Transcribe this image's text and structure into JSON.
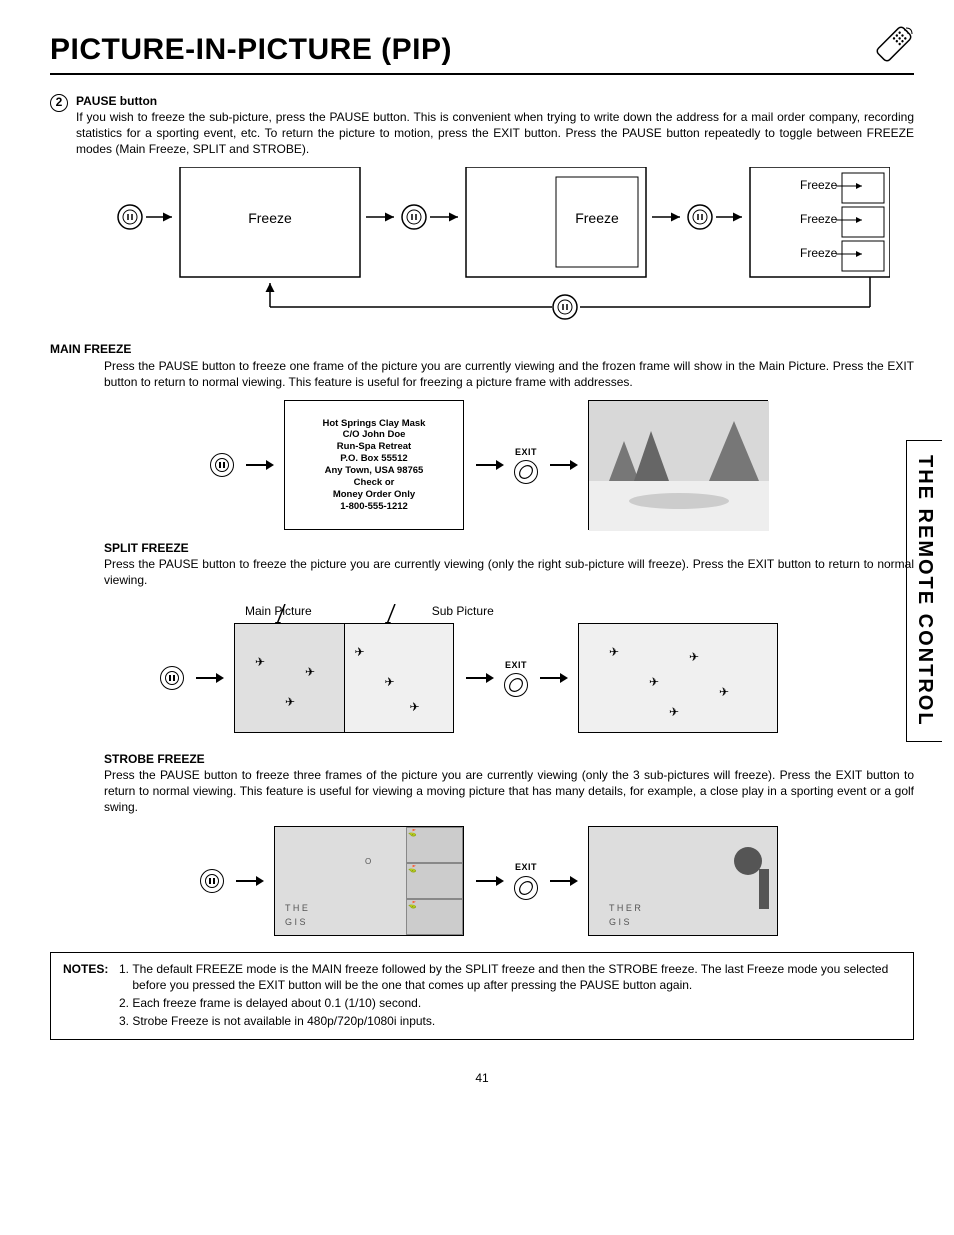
{
  "header": {
    "title": "PICTURE-IN-PICTURE (PIP)"
  },
  "side_tab": "THE REMOTE CONTROL",
  "step": {
    "number": "2",
    "heading": "PAUSE button",
    "text": "If you wish to freeze the sub-picture, press the PAUSE button. This is convenient when trying to write down the address for a mail order company, recording statistics for a sporting event, etc.  To return the picture to motion, press the EXIT button.  Press the PAUSE button repeatedly to toggle between FREEZE modes (Main Freeze, SPLIT and STROBE)."
  },
  "top_diagram": {
    "freeze": "Freeze"
  },
  "main_freeze": {
    "heading": "MAIN FREEZE",
    "text": "Press the PAUSE button to freeze one frame of the picture you are currently viewing and the frozen frame will show in the Main Picture.  Press the EXIT button to return to normal viewing.  This feature is useful for freezing a picture frame with addresses.",
    "exit": "EXIT",
    "panel_lines": [
      "Hot Springs Clay Mask",
      "C/O John Doe",
      "Run-Spa Retreat",
      "P.O. Box 55512",
      "Any Town, USA 98765",
      "Check or",
      "Money Order Only",
      "1-800-555-1212"
    ]
  },
  "split_freeze": {
    "heading": "SPLIT FREEZE",
    "text": "Press the PAUSE button to freeze the picture you are currently viewing (only the right sub-picture will freeze).  Press the EXIT button to return to normal viewing.",
    "main_label": "Main Picture",
    "sub_label": "Sub Picture",
    "exit": "EXIT"
  },
  "strobe_freeze": {
    "heading": "STROBE FREEZE",
    "text": "Press the PAUSE button to freeze three frames of the picture you are currently viewing (only the 3 sub-pictures will freeze). Press the EXIT button to return to normal viewing. This feature is useful for viewing a moving picture that has many details, for example, a close play in a sporting event or a golf swing.",
    "exit": "EXIT"
  },
  "notes": {
    "label": "NOTES:",
    "items": [
      "The default FREEZE mode is the MAIN freeze followed by the SPLIT freeze and then the STROBE freeze.  The last Freeze mode you selected before you pressed the EXIT button will be the one that comes up after pressing the PAUSE button again.",
      "Each freeze frame is delayed about 0.1 (1/10) second.",
      "Strobe Freeze is not available in 480p/720p/1080i inputs."
    ]
  },
  "page_number": "41"
}
